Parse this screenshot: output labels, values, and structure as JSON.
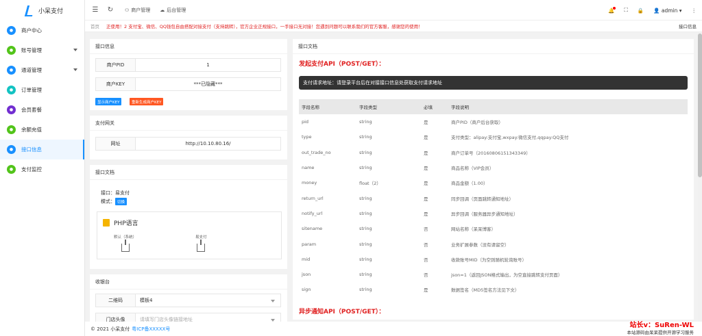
{
  "app": {
    "title": "小呆支付"
  },
  "sidebar": {
    "items": [
      {
        "label": "商户中心",
        "color": "#1890ff"
      },
      {
        "label": "账号管理",
        "color": "#52c41a"
      },
      {
        "label": "通道管理",
        "color": "#1890ff"
      },
      {
        "label": "订单管理",
        "color": "#13c2c2"
      },
      {
        "label": "会员套餐",
        "color": "#722ed1"
      },
      {
        "label": "余额充值",
        "color": "#52c41a"
      },
      {
        "label": "接口信息",
        "color": "#1890ff"
      },
      {
        "label": "支付监控",
        "color": "#52c41a"
      }
    ]
  },
  "topbar": {
    "tabs": [
      "商户管理",
      "后台管理"
    ],
    "user": "admin"
  },
  "notice": {
    "home": "首页",
    "message": "正使用！2 支付宝、微信、QQ钱包自由搭配对接支付（支持跳转），官方企业正规接口，一手接口无对接！您遇到问题可以联系我们的官方客服，感谢您的使用！",
    "right": "接口信息"
  },
  "info": {
    "title": "接口信息",
    "pid_label": "商户PID",
    "pid_value": "1",
    "key_label": "商户KEY",
    "key_value": "***已隐藏***",
    "show_key": "显示商户KEY",
    "reset_key": "重新生成商户KEY"
  },
  "gateway": {
    "title": "支付网关",
    "label": "网址",
    "value": "http://10.10.80.16/"
  },
  "doc": {
    "title": "接口文档",
    "iface": "接口：易支付",
    "mode": "模式：",
    "switch": "切换",
    "lang": "PHP语言",
    "dl1": "默认（系统）",
    "dl2": "易支付"
  },
  "cashier": {
    "title": "收银台",
    "label1": "二维码",
    "value1": "模板4",
    "label2": "门店头像",
    "value2": "请填写门店头像链接地址"
  },
  "api": {
    "title": "接口文档",
    "section1": "发起支付API（POST/GET）：",
    "url_note": "支付请求地址：请登录平台后在对接接口信息处获取支付请求地址",
    "headers": [
      "字段名称",
      "字段类型",
      "必填",
      "字段说明"
    ],
    "rows": [
      [
        "pid",
        "string",
        "是",
        "商户PID（商户后台获取）"
      ],
      [
        "type",
        "string",
        "是",
        "支付类型：alipay:支付宝,wxpay:微信支付,qqpay:QQ支付"
      ],
      [
        "out_trade_no",
        "string",
        "是",
        "商户订单号（20160806151343349）"
      ],
      [
        "name",
        "string",
        "是",
        "商品名称（VIP会员）"
      ],
      [
        "money",
        "float（2）",
        "是",
        "商品金额（1.00）"
      ],
      [
        "return_url",
        "string",
        "是",
        "同步回调（页面跳转通知地址）"
      ],
      [
        "notify_url",
        "string",
        "是",
        "异步回调（服务器异步通知地址）"
      ],
      [
        "sitename",
        "string",
        "否",
        "网站名称（呆呆博客）"
      ],
      [
        "param",
        "string",
        "否",
        "业务扩展参数（没有请留空）"
      ],
      [
        "mid",
        "string",
        "否",
        "收款账号MID（为空则随机轮询账号）"
      ],
      [
        "json",
        "string",
        "否",
        "json=1（返回JSON格式输出，为空直接跳转支付页面）"
      ],
      [
        "sign",
        "string",
        "是",
        "数据签名（MD5签名方法见下文）"
      ]
    ],
    "section2": "异步通知API（POST/GET）："
  },
  "footer": {
    "copyright": "© 2021 小呆支付",
    "icp": "粤ICP备XXXXX号"
  },
  "watermark": {
    "line1": "站长v：SuRen-WL",
    "line2": "本站源码由呆呆提供开源学习服务"
  }
}
